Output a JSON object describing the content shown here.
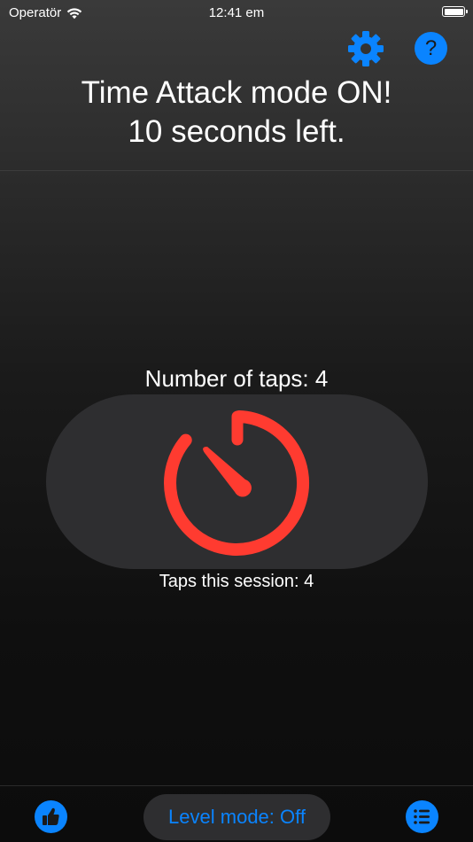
{
  "status_bar": {
    "carrier": "Operatör",
    "time": "12:41 em"
  },
  "header": {
    "line1": "Time Attack mode ON!",
    "line2": "10 seconds left."
  },
  "counter": {
    "taps_label": "Number of taps: 4",
    "session_label": "Taps this session: 4"
  },
  "bottom_bar": {
    "level_mode_label": "Level mode: Off"
  },
  "icons": {
    "settings": "gear-icon",
    "help": "question-mark-icon",
    "timer": "stopwatch-icon",
    "like": "thumbs-up-icon",
    "list": "list-icon"
  },
  "colors": {
    "accent": "#0a84ff",
    "timer": "#ff3b30",
    "button_bg": "#2e2e30"
  }
}
